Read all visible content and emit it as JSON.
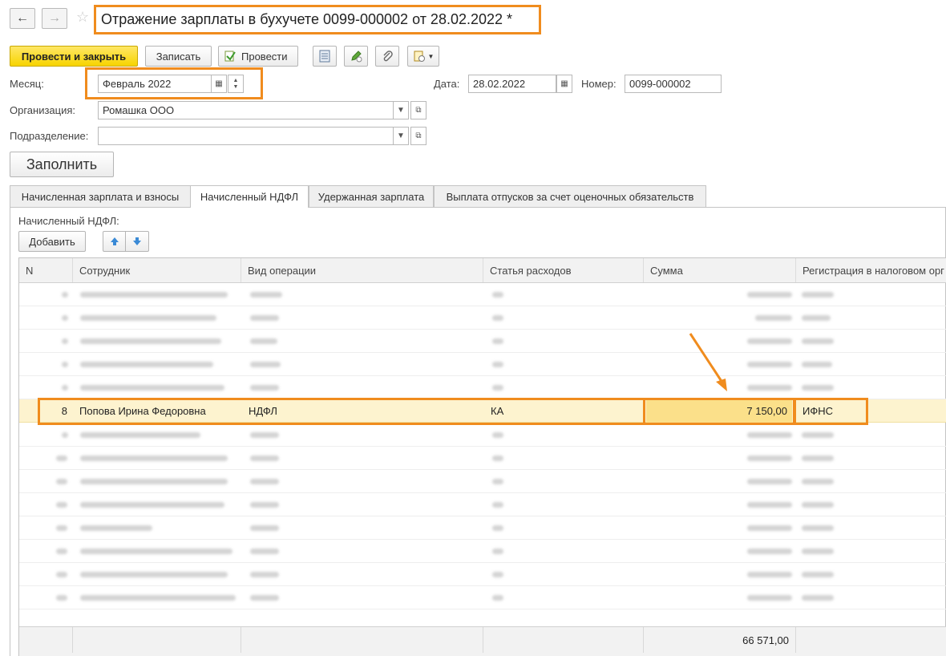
{
  "window": {
    "title": "Отражение зарплаты в бухучете 0099-000002 от 28.02.2022 *"
  },
  "toolbar": {
    "post_close_label": "Провести и закрыть",
    "save_label": "Записать",
    "post_label": "Провести"
  },
  "form": {
    "month_label": "Месяц:",
    "month_value": "Февраль 2022",
    "date_label": "Дата:",
    "date_value": "28.02.2022",
    "number_label": "Номер:",
    "number_value": "0099-000002",
    "org_label": "Организация:",
    "org_value": "Ромашка ООО",
    "dept_label": "Подразделение:",
    "dept_value": "",
    "fill_label": "Заполнить"
  },
  "tabs": [
    {
      "label": "Начисленная зарплата и взносы"
    },
    {
      "label": "Начисленный НДФЛ"
    },
    {
      "label": "Удержанная зарплата"
    },
    {
      "label": "Выплата отпусков за счет оценочных обязательств"
    }
  ],
  "section": {
    "title": "Начисленный НДФЛ:",
    "add_label": "Добавить"
  },
  "table": {
    "columns": [
      "N",
      "Сотрудник",
      "Вид операции",
      "Статья расходов",
      "Сумма",
      "Регистрация в налоговом орг"
    ],
    "selected_row": {
      "n": "8",
      "employee": "Попова Ирина Федоровна",
      "operation": "НДФЛ",
      "expense": "КА",
      "amount": "7 150,00",
      "tax_registration": "ИФНС"
    },
    "total": "66 571,00"
  },
  "colors": {
    "highlight": "#f08c1e",
    "selected_row_bg": "#fdf3cf",
    "primary_button": "#f7d400"
  }
}
